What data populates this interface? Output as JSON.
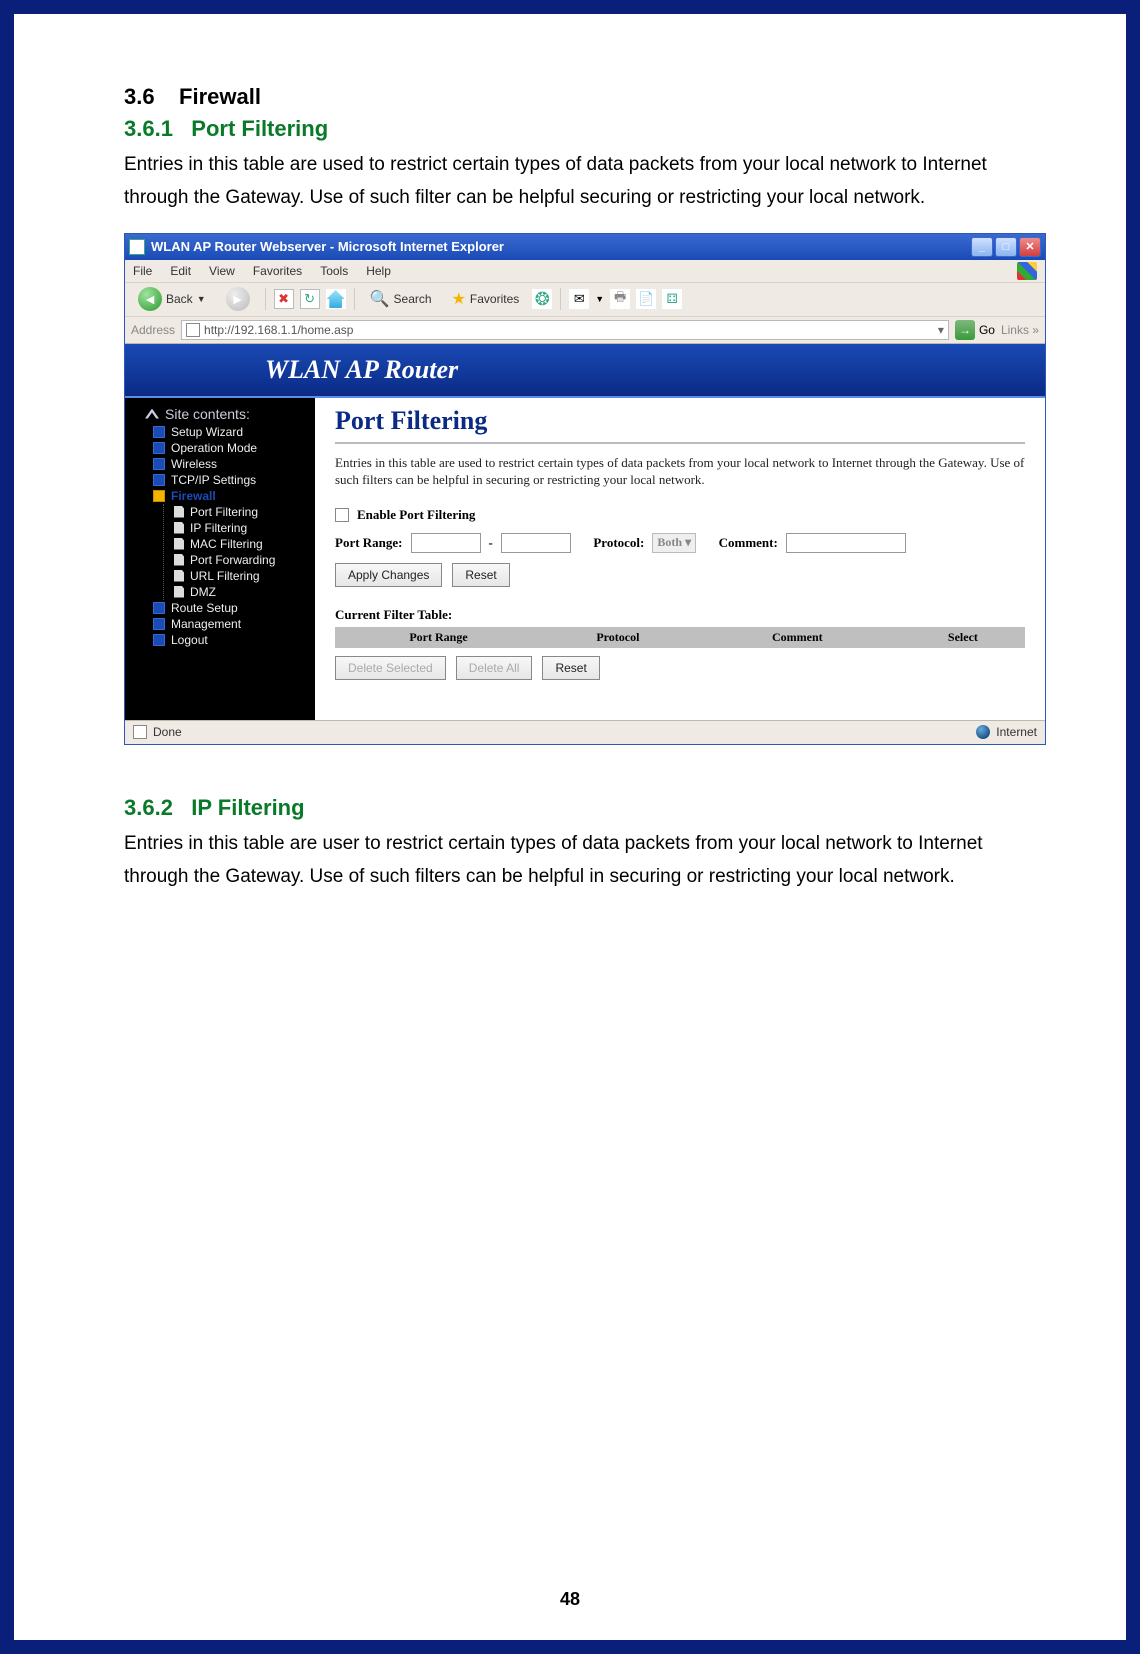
{
  "doc": {
    "section_num": "3.6",
    "section_title": "Firewall",
    "sub1_num": "3.6.1",
    "sub1_title": "Port Filtering",
    "sub1_para": "Entries in this table are used to restrict certain types of data packets from your local network to Internet through the Gateway. Use of such filter can be helpful securing or restricting your local network.",
    "sub2_num": "3.6.2",
    "sub2_title": "IP Filtering",
    "sub2_para": "Entries in this table are user to restrict certain types of data packets from your local network to Internet through the Gateway. Use of such filters can be helpful in securing or restricting your local network.",
    "page_number": "48"
  },
  "browser": {
    "title": "WLAN AP Router Webserver - Microsoft Internet Explorer",
    "menus": {
      "file": "File",
      "edit": "Edit",
      "view": "View",
      "favorites": "Favorites",
      "tools": "Tools",
      "help": "Help"
    },
    "toolbar": {
      "back": "Back",
      "search": "Search",
      "favorites": "Favorites"
    },
    "address_label": "Address",
    "url": "http://192.168.1.1/home.asp",
    "go": "Go",
    "links": "Links",
    "banner": "WLAN AP Router",
    "status_left": "Done",
    "status_right": "Internet"
  },
  "sidebar": {
    "title": "Site contents:",
    "items": [
      {
        "label": "Setup Wizard"
      },
      {
        "label": "Operation Mode"
      },
      {
        "label": "Wireless"
      },
      {
        "label": "TCP/IP Settings"
      },
      {
        "label": "Firewall",
        "active": true
      },
      {
        "label": "Port Filtering",
        "sub": true
      },
      {
        "label": "IP Filtering",
        "sub": true
      },
      {
        "label": "MAC Filtering",
        "sub": true
      },
      {
        "label": "Port Forwarding",
        "sub": true
      },
      {
        "label": "URL Filtering",
        "sub": true
      },
      {
        "label": "DMZ",
        "sub": true
      },
      {
        "label": "Route Setup"
      },
      {
        "label": "Management"
      },
      {
        "label": "Logout"
      }
    ]
  },
  "main": {
    "title": "Port Filtering",
    "desc": "Entries in this table are used to restrict certain types of data packets from your local network to Internet through the Gateway. Use of such filters can be helpful in securing or restricting your local network.",
    "enable_label": "Enable Port Filtering",
    "port_range_label": "Port Range:",
    "protocol_label": "Protocol:",
    "protocol_value": "Both",
    "comment_label": "Comment:",
    "apply": "Apply Changes",
    "reset": "Reset",
    "table_title": "Current Filter Table:",
    "columns": {
      "c1": "Port Range",
      "c2": "Protocol",
      "c3": "Comment",
      "c4": "Select"
    },
    "delete_selected": "Delete Selected",
    "delete_all": "Delete All",
    "reset2": "Reset"
  }
}
